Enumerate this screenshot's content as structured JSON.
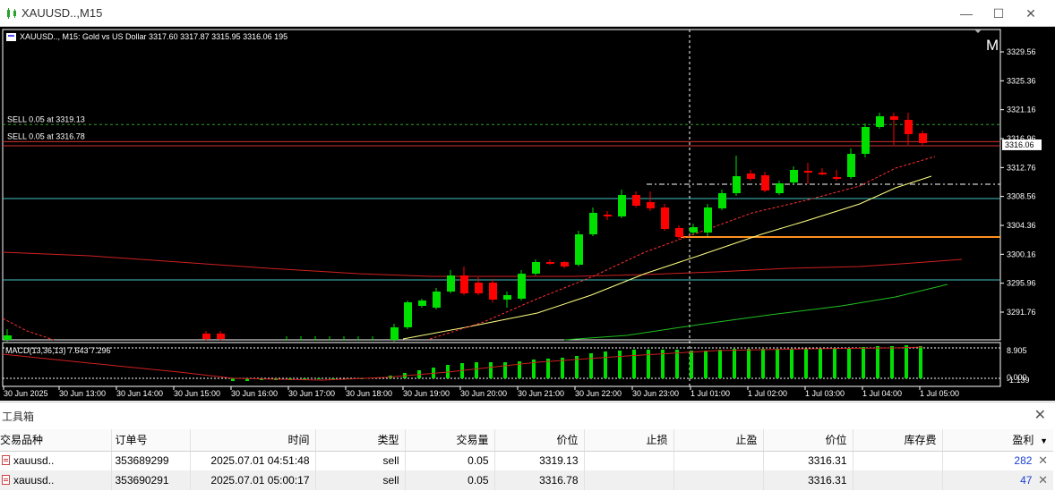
{
  "window": {
    "title": "XAUUSD..,M15",
    "minimize": "—",
    "maximize": "☐",
    "close": "✕"
  },
  "chart": {
    "header": "XAUUSD.., M15:  Gold vs US Dollar  3317.60 3317.87 3315.95 3316.06  195",
    "corner_badge": "M",
    "macd_label": "MACD(13,36,13) 7.643 7.296",
    "price_levels": [
      "3329.56",
      "3325.36",
      "3321.16",
      "3316.96",
      "3312.76",
      "3308.56",
      "3304.36",
      "3300.16",
      "3295.96",
      "3291.76"
    ],
    "current_price": "3316.06",
    "macd_levels": [
      "8.905",
      "0.000",
      "-1.139"
    ],
    "time_labels": [
      "30 Jun 2025",
      "30 Jun 13:00",
      "30 Jun 14:00",
      "30 Jun 15:00",
      "30 Jun 16:00",
      "30 Jun 17:00",
      "30 Jun 18:00",
      "30 Jun 19:00",
      "30 Jun 20:00",
      "30 Jun 21:00",
      "30 Jun 22:00",
      "30 Jun 23:00",
      "1 Jul 01:00",
      "1 Jul 02:00",
      "1 Jul 03:00",
      "1 Jul 04:00",
      "1 Jul 05:00"
    ],
    "orders": [
      {
        "label": "SELL 0.05 at 3319.13",
        "price": 3319.13
      },
      {
        "label": "SELL 0.05 at 3316.78",
        "price": 3316.78
      }
    ],
    "colors": {
      "bull": "#00e000",
      "bear": "#ff0000",
      "ma_fast": "#ff3030",
      "ma_mid": "#ffff80",
      "ma_slow": "#d02020",
      "ma_long": "#20c020",
      "hline_cyan": "#40c0c0",
      "hline_orange": "#ff9020"
    }
  },
  "toolbox": {
    "title": "工具箱",
    "close": "✕",
    "columns": [
      "交易品种",
      "订单号",
      "时间",
      "类型",
      "交易量",
      "价位",
      "止损",
      "止盈",
      "价位",
      "库存费",
      "盈利"
    ],
    "sort_indicator": "▼",
    "rows": [
      {
        "symbol": "xauusd..",
        "order": "353689299",
        "time": "2025.07.01 04:51:48",
        "type": "sell",
        "volume": "0.05",
        "open_price": "3319.13",
        "sl": "",
        "tp": "",
        "price": "3316.31",
        "swap": "",
        "profit": "282",
        "close": "✕"
      },
      {
        "symbol": "xauusd..",
        "order": "353690291",
        "time": "2025.07.01 05:00:17",
        "type": "sell",
        "volume": "0.05",
        "open_price": "3316.78",
        "sl": "",
        "tp": "",
        "price": "3316.31",
        "swap": "",
        "profit": "47",
        "close": "✕"
      }
    ]
  }
}
